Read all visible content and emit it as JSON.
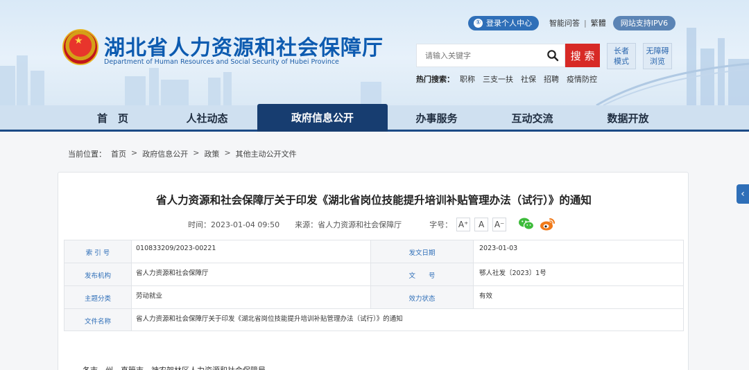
{
  "header": {
    "title": "湖北省人力资源和社会保障厅",
    "subtitle": "Department of Human Resources and Social Security of Hubei Province",
    "emblem_icon": "national-emblem-icon"
  },
  "top_links": {
    "login": "登录个人中心",
    "qa": "智能问答",
    "separator": "|",
    "traditional": "繁體",
    "ipv6": "网站支持IPV6"
  },
  "search": {
    "placeholder": "请输入关键字",
    "button": "搜 索",
    "elder_mode_line1": "长者",
    "elder_mode_line2": "模式",
    "accessible_line1": "无障碍",
    "accessible_line2": "浏览",
    "hot_label": "热门搜索：",
    "hot_terms": [
      "职称",
      "三支一扶",
      "社保",
      "招聘",
      "疫情防控"
    ]
  },
  "nav": {
    "items": [
      "首　页",
      "人社动态",
      "政府信息公开",
      "办事服务",
      "互动交流",
      "数据开放"
    ],
    "active_index": 2
  },
  "breadcrumb": {
    "label": "当前位置：",
    "items": [
      "首页",
      "政府信息公开",
      "政策",
      "其他主动公开文件"
    ],
    "separator": ">"
  },
  "article": {
    "title": "省人力资源和社会保障厅关于印发《湖北省岗位技能提升培训补贴管理办法（试行）》的通知",
    "time_label": "时间：",
    "time": "2023-01-04 09:50",
    "source_label": "来源：",
    "source": "省人力资源和社会保障厅",
    "font_label": "字号：",
    "font_sizes": [
      "A⁺",
      "A",
      "A⁻"
    ],
    "body_start": "各市、州、直管市、神农架林区人力资源和社会保障局"
  },
  "info_table": {
    "index_label": "索 引 号",
    "index_value": "010833209/2023-00221",
    "date_label": "发文日期",
    "date_value": "2023-01-03",
    "org_label": "发布机构",
    "org_value": "省人力资源和社会保障厅",
    "docno_label": "文　　号",
    "docno_value": "鄂人社发〔2023〕1号",
    "topic_label": "主题分类",
    "topic_value": "劳动就业",
    "status_label": "效力状态",
    "status_value": "有效",
    "name_label": "文件名称",
    "name_value": "省人力资源和社会保障厅关于印发《湖北省岗位技能提升培训补贴管理办法（试行）》的通知"
  },
  "colors": {
    "brand_blue": "#0d5bb0",
    "nav_active": "#173d70",
    "search_red": "#d72a26",
    "label_blue": "#2f6fb8",
    "wechat_green": "#3dbb3a",
    "weibo_orange": "#f07a1a"
  }
}
